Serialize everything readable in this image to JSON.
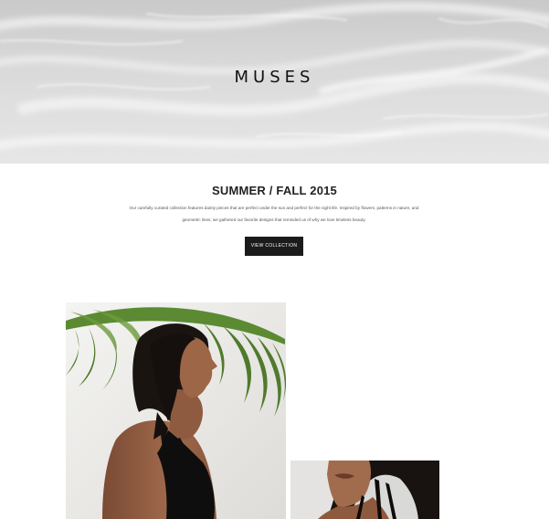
{
  "hero": {
    "brand": "MUSES"
  },
  "collection": {
    "title": "SUMMER / FALL 2015",
    "description": "Our carefully curated collection features dainty pieces that are perfect under the sun and perfect for the night life. Inspired by flowers, patterns in nature, and geometric lines, we gathered our favorite designs that reminded us of why we love timeless beauty.",
    "button_label": "VIEW COLLECTION"
  },
  "colors": {
    "button_bg": "#1b1b1b",
    "button_text": "#ffffff",
    "text_dark": "#222222",
    "hero_sky": "#d4d4d4"
  }
}
